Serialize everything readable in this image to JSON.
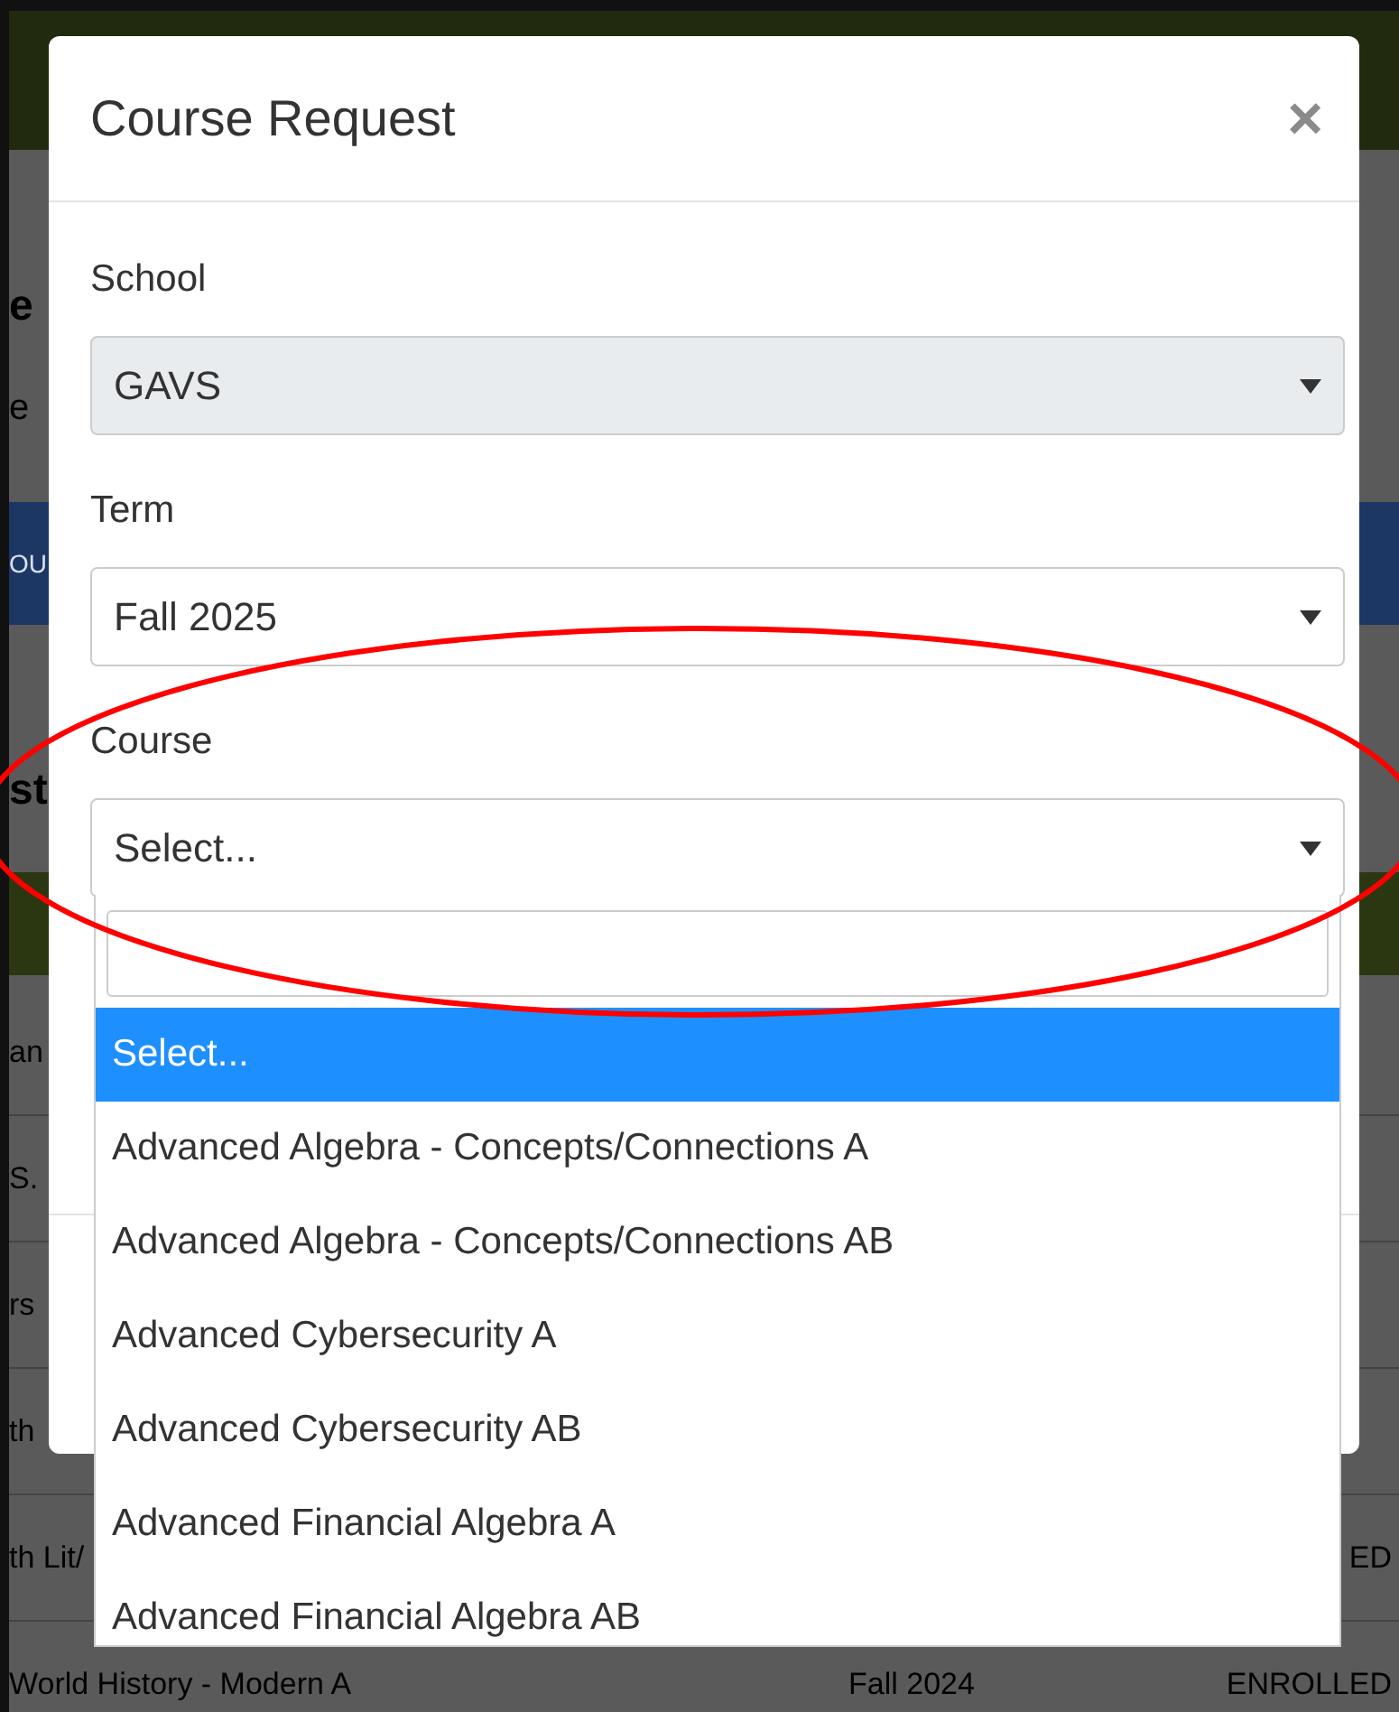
{
  "background": {
    "heading": "e",
    "subtext": "e",
    "button": "OU",
    "section_heading": "st",
    "rows": [
      {
        "course": "an"
      },
      {
        "course": "S."
      },
      {
        "course": "rs"
      },
      {
        "course": "th"
      },
      {
        "course": "th Lit/",
        "status": "ED"
      },
      {
        "course": "World History - Modern A",
        "term": "Fall 2024",
        "status": "ENROLLED"
      }
    ]
  },
  "modal": {
    "title": "Course Request",
    "close": "×",
    "fields": [
      {
        "label": "School",
        "value": "GAVS",
        "disabled": true,
        "expanded": false
      },
      {
        "label": "Term",
        "value": "Fall 2025",
        "disabled": false,
        "expanded": false
      },
      {
        "label": "Course",
        "value": "Select...",
        "disabled": false,
        "expanded": true
      }
    ],
    "dropdown": {
      "options": [
        {
          "label": "Select...",
          "selected": true
        },
        {
          "label": "Advanced Algebra - Concepts/Connections A",
          "selected": false
        },
        {
          "label": "Advanced Algebra - Concepts/Connections AB",
          "selected": false
        },
        {
          "label": "Advanced Cybersecurity A",
          "selected": false
        },
        {
          "label": "Advanced Cybersecurity AB",
          "selected": false
        },
        {
          "label": "Advanced Financial Algebra A",
          "selected": false
        },
        {
          "label": "Advanced Financial Algebra AB",
          "selected": false
        }
      ]
    }
  },
  "annotations": [
    {
      "kind": "ellipse"
    }
  ]
}
